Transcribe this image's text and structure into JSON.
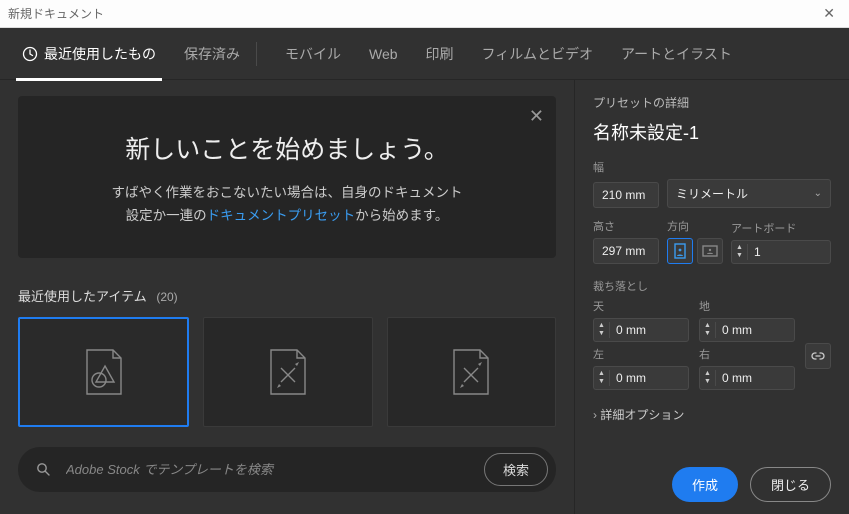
{
  "window": {
    "title": "新規ドキュメント"
  },
  "tabs": {
    "recent": "最近使用したもの",
    "saved": "保存済み",
    "mobile": "モバイル",
    "web": "Web",
    "print": "印刷",
    "film": "フィルムとビデオ",
    "art": "アートとイラスト",
    "active": "recent"
  },
  "hero": {
    "heading": "新しいことを始めましょう。",
    "text_before": "すばやく作業をおこないたい場合は、自身のドキュメント設定か一連の",
    "link_text": "ドキュメントプリセット",
    "text_after": "から始めます。"
  },
  "recent": {
    "label": "最近使用したアイテム",
    "count": "(20)"
  },
  "search": {
    "placeholder": "Adobe Stock でテンプレートを検索",
    "button": "検索"
  },
  "details": {
    "title": "プリセットの詳細",
    "name": "名称未設定-1",
    "width_label": "幅",
    "width_value": "210 mm",
    "unit_label": "ミリメートル",
    "height_label": "高さ",
    "height_value": "297 mm",
    "orientation_label": "方向",
    "artboards_label": "アートボード",
    "artboards_value": "1",
    "bleed_label": "裁ち落とし",
    "bleed": {
      "top_label": "天",
      "top": "0 mm",
      "bottom_label": "地",
      "bottom": "0 mm",
      "left_label": "左",
      "left": "0 mm",
      "right_label": "右",
      "right": "0 mm"
    },
    "advanced": "詳細オプション"
  },
  "buttons": {
    "create": "作成",
    "close": "閉じる"
  }
}
